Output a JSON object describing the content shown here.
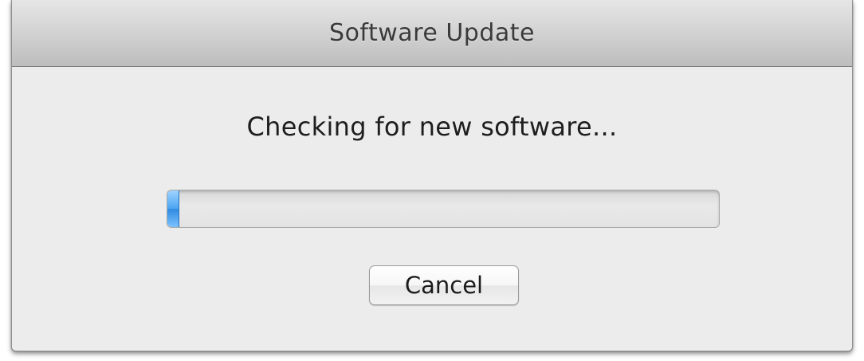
{
  "window": {
    "title": "Software Update"
  },
  "dialog": {
    "message": "Checking for new software...",
    "progress": {
      "fraction": 0.02,
      "indeterminate": false,
      "fill_color": "#4aa4f1"
    },
    "cancel_label": "Cancel"
  }
}
